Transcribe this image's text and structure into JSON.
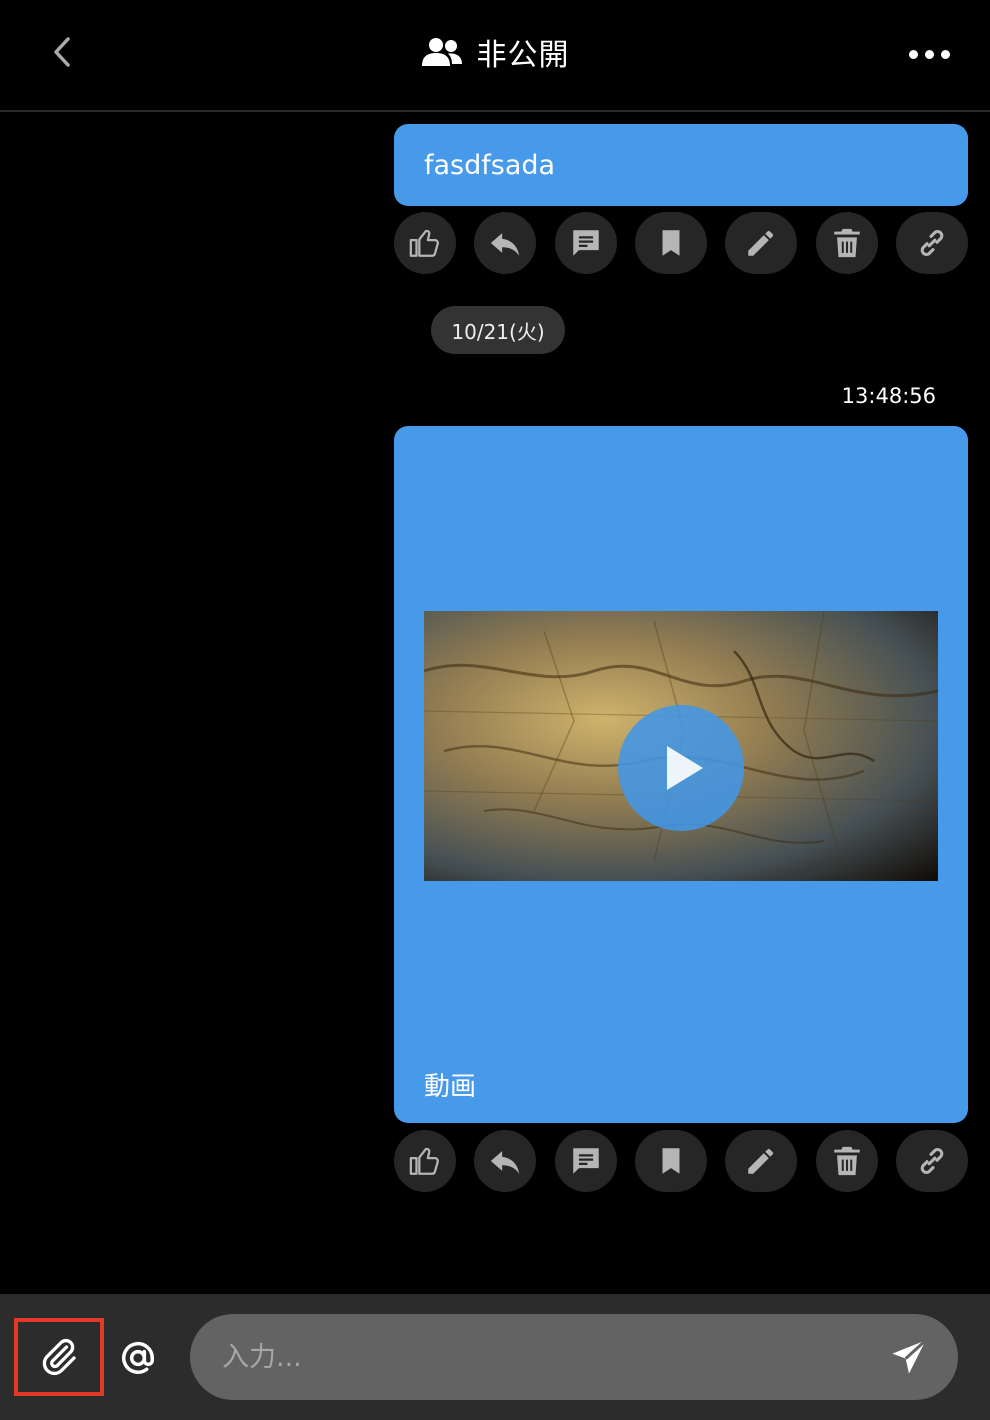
{
  "header": {
    "title": "非公開",
    "back_icon": "chevron-left-icon",
    "group_icon": "users-icon",
    "more_icon": "more-horizontal-icon"
  },
  "messages": [
    {
      "text": "fasdfsada"
    },
    {
      "video_caption": "動画"
    }
  ],
  "date_separator": "10/21(火)",
  "timestamp": "13:48:56",
  "actions": [
    "like-icon",
    "reply-icon",
    "comment-icon",
    "bookmark-icon",
    "edit-icon",
    "delete-icon",
    "link-icon"
  ],
  "composer": {
    "placeholder": "入力...",
    "attach_icon": "paperclip-icon",
    "mention_icon": "at-icon",
    "send_icon": "send-icon"
  },
  "colors": {
    "bubble": "#4799ea",
    "action_bg": "#262626",
    "icon": "#b5b5b5",
    "highlight": "#e13a26"
  }
}
